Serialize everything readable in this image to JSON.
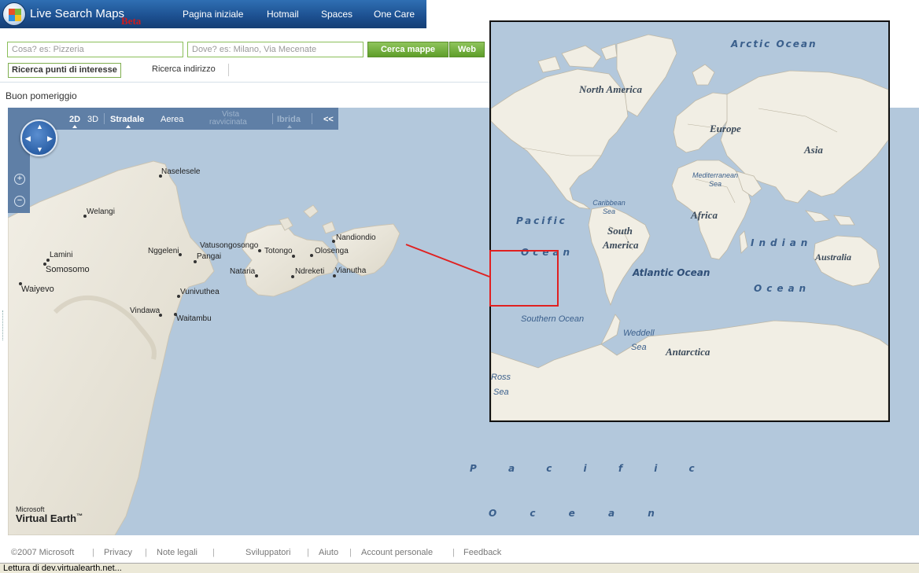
{
  "header": {
    "brand": "Live Search Maps",
    "beta": "Beta",
    "nav": [
      "Pagina iniziale",
      "Hotmail",
      "Spaces",
      "One Care"
    ]
  },
  "search": {
    "what_placeholder": "Cosa? es: Pizzeria",
    "where_placeholder": "Dove? es: Milano, Via Mecenate",
    "search_maps_label": "Cerca mappe",
    "web_label": "Web",
    "tab_poi": "Ricerca punti di interesse",
    "tab_address": "Ricerca indirizzo"
  },
  "greeting": "Buon pomeriggio",
  "map_toolbar": {
    "mode_2d": "2D",
    "mode_3d": "3D",
    "stradale": "Stradale",
    "aerea": "Aerea",
    "vista_1": "Vista",
    "vista_2": "ravvicinata",
    "ibrida": "Ibrida",
    "collapse": "<<"
  },
  "map_places": [
    "Naselesele",
    "Welangi",
    "Lamini",
    "Somosomo",
    "Waiyevo",
    "Nggeleni",
    "Vatusongosongo",
    "Pangai",
    "Totongo",
    "Olosenga",
    "Nandiondio",
    "Nataria",
    "Ndreketi",
    "Vianutha",
    "Vunivuthea",
    "Vindawa",
    "Waitambu"
  ],
  "map_ocean_1": "P a c i f i c",
  "map_ocean_2": "O c e a n",
  "branding": {
    "microsoft": "Microsoft",
    "virtual_earth": "Virtual Earth",
    "tm": "™"
  },
  "inset": {
    "arctic": "Arctic Ocean",
    "north_america": "North America",
    "europe": "Europe",
    "asia": "Asia",
    "mediterranean_1": "Mediterranean",
    "mediterranean_2": "Sea",
    "caribbean_1": "Caribbean",
    "caribbean_2": "Sea",
    "pacific_1": "Pacific",
    "pacific_2": "Ocean",
    "africa": "Africa",
    "south_america_1": "South",
    "south_america_2": "America",
    "indian_1": "Indian",
    "indian_2": "Ocean",
    "australia": "Australia",
    "atlantic": "Atlantic Ocean",
    "southern": "Southern Ocean",
    "weddell_1": "Weddell",
    "weddell_2": "Sea",
    "antarctica": "Antarctica",
    "ross_1": "Ross",
    "ross_2": "Sea"
  },
  "footer": [
    "©2007 Microsoft",
    "Privacy",
    "Note legali",
    "Sviluppatori",
    "Aiuto",
    "Account personale",
    "Feedback"
  ],
  "status": "Lettura di dev.virtualearth.net..."
}
